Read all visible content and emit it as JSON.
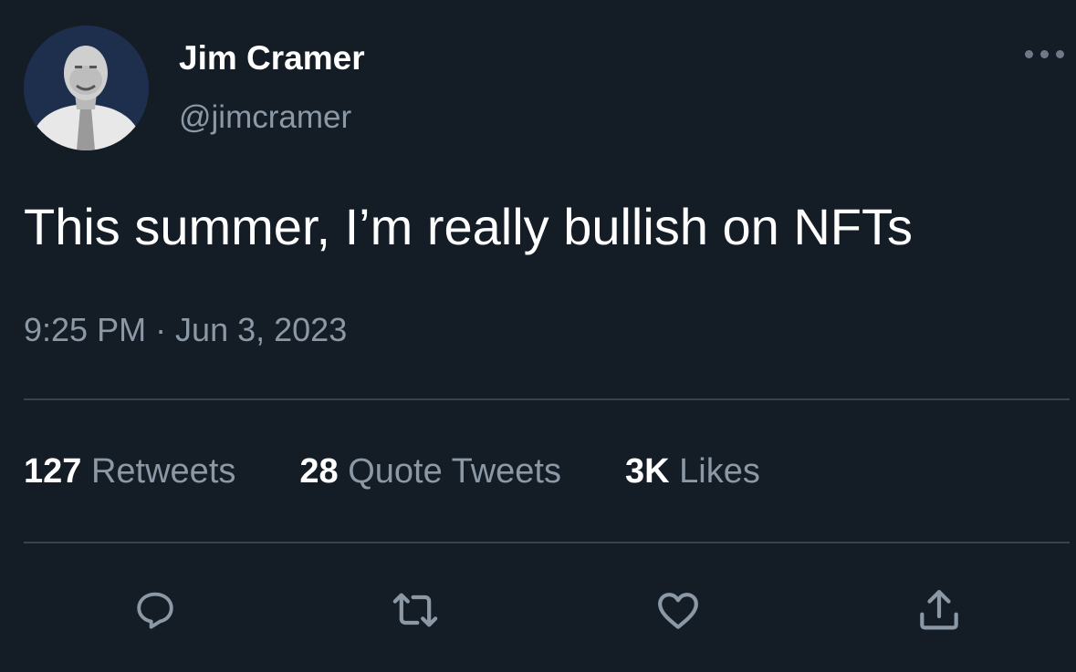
{
  "tweet": {
    "author_name": "Jim Cramer",
    "author_handle": "@jimcramer",
    "text": "This summer, I’m really bullish on NFTs",
    "timestamp": "9:25 PM · Jun 3, 2023"
  },
  "stats": {
    "retweets_count": "127",
    "retweets_label": "Retweets",
    "quotes_count": "28",
    "quotes_label": "Quote Tweets",
    "likes_count": "3K",
    "likes_label": "Likes"
  },
  "actions": {
    "reply_icon": "reply-icon",
    "retweet_icon": "retweet-icon",
    "like_icon": "heart-icon",
    "share_icon": "share-icon",
    "more_icon": "more-icon"
  },
  "colors": {
    "background": "#141c26",
    "primary_text": "#ffffff",
    "secondary_text": "#8b98a5",
    "divider": "#38444d"
  }
}
